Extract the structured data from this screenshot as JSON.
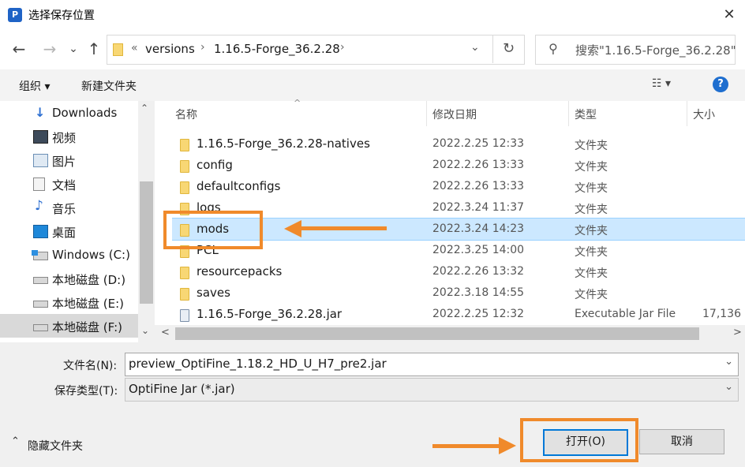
{
  "window": {
    "title": "选择保存位置",
    "app_icon_letter": "P",
    "close_glyph": "✕"
  },
  "nav": {
    "back": "←",
    "forward": "→",
    "recent": "⌄",
    "up": "↑",
    "breadcrumb_overflow": "«",
    "crumbs": [
      "versions",
      "1.16.5-Forge_36.2.28"
    ],
    "sep": "›",
    "refresh": "↻",
    "search_placeholder": "搜索\"1.16.5-Forge_36.2.28\""
  },
  "toolbar": {
    "organize": "组织 ▾",
    "new_folder": "新建文件夹",
    "view_glyph": "☷ ▾",
    "help": "?"
  },
  "sidebar": {
    "items": [
      {
        "label": "Downloads",
        "icon": "download-arrow-icon"
      },
      {
        "label": "视频",
        "icon": "film-icon"
      },
      {
        "label": "图片",
        "icon": "picture-icon"
      },
      {
        "label": "文档",
        "icon": "document-icon"
      },
      {
        "label": "音乐",
        "icon": "music-note-icon"
      },
      {
        "label": "桌面",
        "icon": "desktop-icon"
      },
      {
        "label": "Windows (C:)",
        "icon": "windows-drive-icon"
      },
      {
        "label": "本地磁盘 (D:)",
        "icon": "drive-icon"
      },
      {
        "label": "本地磁盘 (E:)",
        "icon": "drive-icon"
      },
      {
        "label": "本地磁盘 (F:)",
        "icon": "drive-icon"
      }
    ],
    "selected_index": 9,
    "scroll_up": "⌃",
    "scroll_down": "⌄"
  },
  "files": {
    "sort_indicator": "^",
    "columns": [
      "名称",
      "修改日期",
      "类型",
      "大小"
    ],
    "rows": [
      {
        "name": "1.16.5-Forge_36.2.28-natives",
        "date": "2022.2.25 12:33",
        "type": "文件夹",
        "size": ""
      },
      {
        "name": "config",
        "date": "2022.2.26 13:33",
        "type": "文件夹",
        "size": ""
      },
      {
        "name": "defaultconfigs",
        "date": "2022.2.26 13:33",
        "type": "文件夹",
        "size": ""
      },
      {
        "name": "logs",
        "date": "2022.3.24 11:37",
        "type": "文件夹",
        "size": ""
      },
      {
        "name": "mods",
        "date": "2022.3.24 14:23",
        "type": "文件夹",
        "size": ""
      },
      {
        "name": "PCL",
        "date": "2022.3.25 14:00",
        "type": "文件夹",
        "size": ""
      },
      {
        "name": "resourcepacks",
        "date": "2022.2.26 13:32",
        "type": "文件夹",
        "size": ""
      },
      {
        "name": "saves",
        "date": "2022.3.18 14:55",
        "type": "文件夹",
        "size": ""
      },
      {
        "name": "1.16.5-Forge_36.2.28.jar",
        "date": "2022.2.25 12:32",
        "type": "Executable Jar File",
        "size": "17,136"
      }
    ],
    "selected_index": 4,
    "hscroll_left": "<",
    "hscroll_right": ">"
  },
  "form": {
    "filename_label": "文件名(N):",
    "filename_value": "preview_OptiFine_1.18.2_HD_U_H7_pre2.jar",
    "filetype_label": "保存类型(T):",
    "filetype_value": "OptiFine Jar (*.jar)",
    "dropdown_glyph": "⌄"
  },
  "footer": {
    "hide_folders": "隐藏文件夹",
    "hide_glyph": "⌃",
    "open": "打开(O)",
    "cancel": "取消"
  },
  "colors": {
    "highlight": "#f08a2b",
    "selection": "#cce8ff",
    "accent": "#0078d7"
  }
}
